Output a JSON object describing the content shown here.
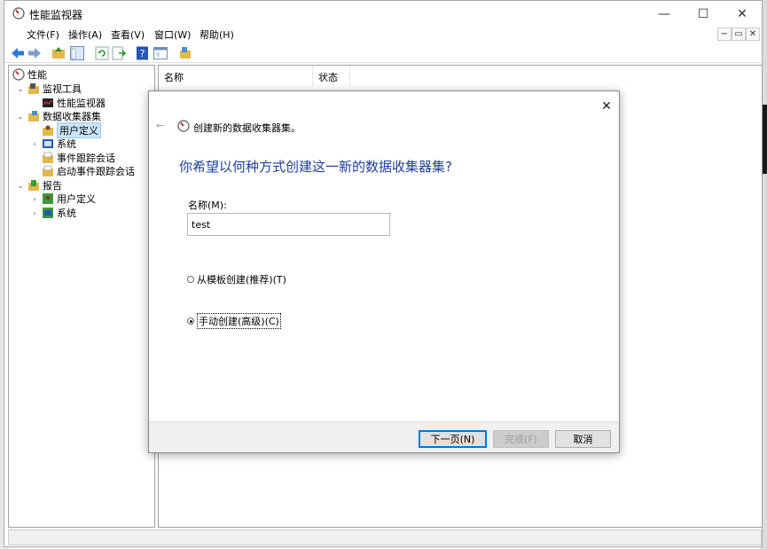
{
  "window": {
    "title": "性能监视器",
    "minimize": "—",
    "maximize": "☐",
    "close": "✕"
  },
  "menu": {
    "items": [
      "文件(F)",
      "操作(A)",
      "查看(V)",
      "窗口(W)",
      "帮助(H)"
    ],
    "mdi_min": "−",
    "mdi_restore": "▭",
    "mdi_close": "✕"
  },
  "tree": {
    "items": [
      {
        "label": "性能",
        "expander": "",
        "icon": "performance-icon"
      },
      {
        "label": "监视工具",
        "expander": "⌄",
        "icon": "monitoring-tools-icon"
      },
      {
        "label": "性能监视器",
        "expander": "",
        "icon": "performance-monitor-icon"
      },
      {
        "label": "数据收集器集",
        "expander": "⌄",
        "icon": "data-collector-sets-icon"
      },
      {
        "label": "用户定义",
        "expander": "",
        "icon": "user-defined-icon"
      },
      {
        "label": "系统",
        "expander": "›",
        "icon": "system-icon"
      },
      {
        "label": "事件跟踪会话",
        "expander": "",
        "icon": "event-trace-icon"
      },
      {
        "label": "启动事件跟踪会话",
        "expander": "",
        "icon": "startup-trace-icon"
      },
      {
        "label": "报告",
        "expander": "⌄",
        "icon": "reports-icon"
      },
      {
        "label": "用户定义",
        "expander": "›",
        "icon": "user-report-icon"
      },
      {
        "label": "系统",
        "expander": "›",
        "icon": "system-report-icon"
      }
    ]
  },
  "list": {
    "columns": [
      "名称",
      "状态"
    ]
  },
  "dialog": {
    "back": "←",
    "close": "✕",
    "caption": "创建新的数据收集器集。",
    "heading": "你希望以何种方式创建这一新的数据收集器集?",
    "name_label": "名称(M):",
    "name_value": "test",
    "option_template": "从模板创建(推荐)(T)",
    "option_manual": "手动创建(高级)(C)",
    "btn_next": "下一页(N)",
    "btn_finish": "完成(F)",
    "btn_cancel": "取消"
  },
  "colors": {
    "heading": "#1f3f9a",
    "selection": "#cce4f7",
    "accent": "#0078d7"
  }
}
